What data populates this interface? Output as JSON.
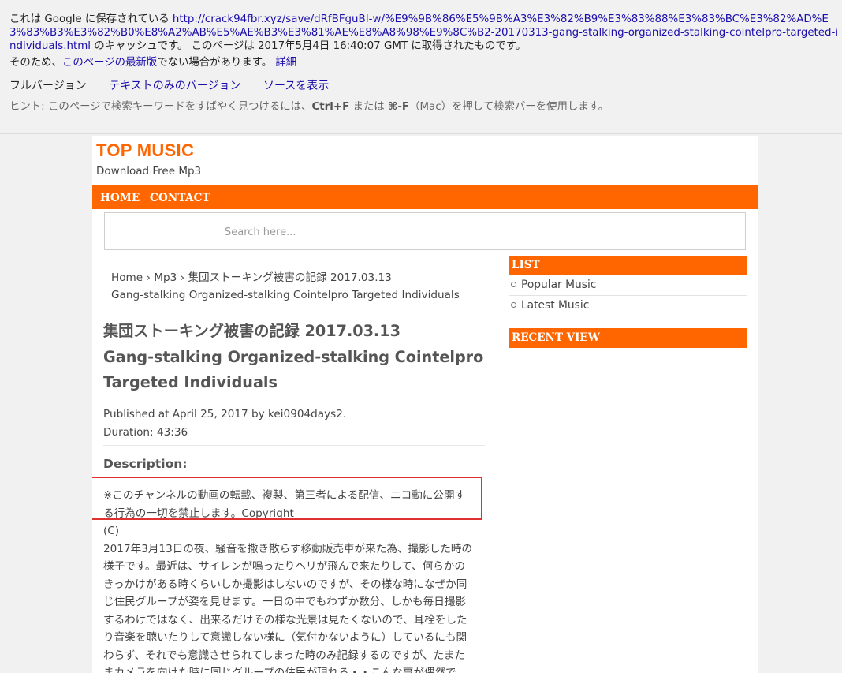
{
  "cache": {
    "prefix": "これは Google に保存されている ",
    "url": "http://crack94fbr.xyz/save/dRfBFguBI-w/%E9%9B%86%E5%9B%A3%E3%82%B9%E3%83%88%E3%83%BC%E3%82%AD%E3%83%B3%E3%82%B0%E8%A2%AB%E5%AE%B3%E3%81%AE%E8%A8%98%E9%8C%B2-20170313-gang-stalking-organized-stalking-cointelpro-targeted-individuals.html",
    "suffix": " のキャッシュです。 このページは 2017年5月4日 16:40:07 GMT に取得されたものです。",
    "line2_prefix": "そのため、",
    "latest_link": "このページの最新版",
    "line2_suffix": "でない場合があります。 ",
    "details_link": "詳細",
    "full_version": "フルバージョン",
    "text_only": "テキストのみのバージョン",
    "view_source": "ソースを表示",
    "hint_prefix": "ヒント: このページで検索キーワードをすばやく見つけるには、",
    "hint_key1": "Ctrl+F",
    "hint_mid": " または ",
    "hint_key2": "⌘-F",
    "hint_suffix": "（Mac）を押して検索バーを使用します。"
  },
  "site": {
    "title": "TOP MUSIC",
    "tagline": "Download Free Mp3",
    "nav": [
      "HOME",
      "CONTACT"
    ],
    "search_placeholder": "Search here..."
  },
  "breadcrumb": {
    "home": "Home",
    "sep": " › ",
    "mp3": "Mp3",
    "current_line1": "集団ストーキング被害の記録 2017.03.13",
    "current_line2": "Gang-stalking Organized-stalking Cointelpro Targeted Individuals"
  },
  "post": {
    "title_line1": "集団ストーキング被害の記録 2017.03.13",
    "title_line2": "Gang-stalking Organized-stalking Cointelpro",
    "title_line3": "Targeted Individuals",
    "published_label": "Published at ",
    "date": "April 25, 2017",
    "by": " by ",
    "author": "kei0904days2.",
    "duration": "Duration: 43:36",
    "desc_heading": "Description:",
    "desc_lines": [
      "※このチャンネルの動画の転載、複製、第三者による配信、ニコ動に公開す",
      "る行為の一切を禁止します。Copyright",
      "(C)",
      "2017年3月13日の夜、騒音を撒き散らす移動販売車が来た為、撮影した時の",
      "様子です。最近は、サイレンが鳴ったりヘリが飛んで来たりして、何らかの",
      "きっかけがある時くらいしか撮影はしないのですが、その様な時になぜか同",
      "じ住民グループが姿を見せます。一日の中でもわずか数分、しかも毎日撮影",
      "するわけではなく、出来るだけその様な光景は見たくないので、耳栓をした",
      "り音楽を聴いたりして意識しない様に（気付かないように）しているにも関",
      "わらず、それでも意識させられてしまった時のみ記録するのですが、たまた",
      "まカメラを向けた時に同じグループの住民が現れる・・こんな事が偶然で"
    ]
  },
  "sidebar": {
    "list_header": "LIST",
    "items": [
      "Popular Music",
      "Latest Music"
    ],
    "recent_header": "RECENT VIEW"
  },
  "colors": {
    "accent": "#ff6600",
    "highlight_border": "#e0312e",
    "link": "#1a0dab"
  }
}
